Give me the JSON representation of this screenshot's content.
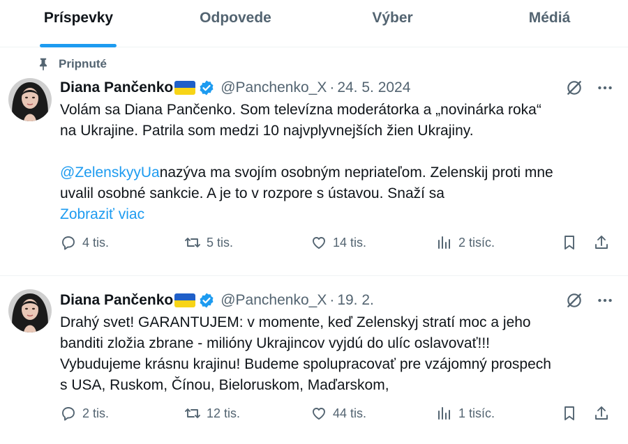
{
  "tabs": [
    {
      "label": "Príspevky",
      "active": true
    },
    {
      "label": "Odpovede",
      "active": false
    },
    {
      "label": "Výber",
      "active": false
    },
    {
      "label": "Médiá",
      "active": false
    }
  ],
  "pinned_label": "Pripnuté",
  "posts": [
    {
      "name": "Diana Pančenko",
      "handle": "@Panchenko_X",
      "separator": "·",
      "date": "24. 5. 2024",
      "lines": [
        "Volám sa Diana Pančenko. Som televízna moderátorka a „novinárka roka“",
        "na Ukrajine. Patrila som medzi 10 najvplyvnejších žien Ukrajiny."
      ],
      "mention": "@ZelenskyyUa",
      "after_mention": "nazýva ma svojím osobným nepriateľom. Zelenskij proti mne",
      "line4": "uvalil osobné sankcie. A je to v rozpore s ústavou. Snaží sa",
      "show_more": "Zobraziť viac",
      "stats": {
        "replies": "4 tis.",
        "reposts": "5 tis.",
        "likes": "14 tis.",
        "views": "2 tisíc."
      }
    },
    {
      "name": "Diana Pančenko",
      "handle": "@Panchenko_X",
      "separator": "·",
      "date": "19. 2.",
      "lines": [
        "Drahý svet! GARANTUJEM: v momente, keď Zelenskyj stratí moc a jeho",
        "banditi zložia zbrane - milióny Ukrajincov vyjdú do ulíc oslavovať!!!",
        "Vybudujeme krásnu krajinu! Budeme spolupracovať pre vzájomný prospech",
        "s USA, Ruskom, Čínou, Bieloruskom, Maďarskom,"
      ],
      "stats": {
        "replies": "2 tis.",
        "reposts": "12 tis.",
        "likes": "44 tis.",
        "views": "1 tisíc."
      }
    }
  ],
  "colors": {
    "accent": "#1d9bf0",
    "muted": "#536471",
    "text": "#0f1419"
  },
  "icons": [
    "pin-icon",
    "verified-icon",
    "grok-icon",
    "more-icon",
    "reply-icon",
    "repost-icon",
    "like-icon",
    "views-icon",
    "bookmark-icon",
    "share-icon"
  ]
}
